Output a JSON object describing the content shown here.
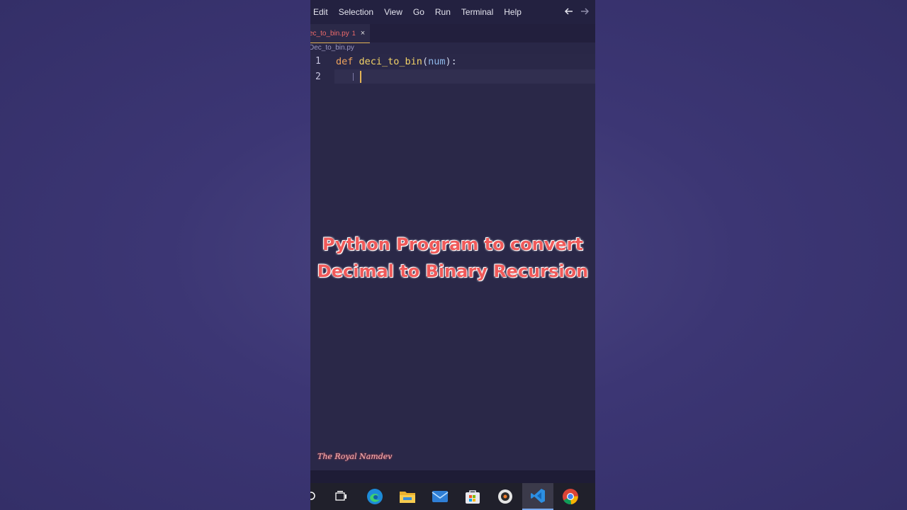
{
  "menu": {
    "items": [
      "Edit",
      "Selection",
      "View",
      "Go",
      "Run",
      "Terminal",
      "Help"
    ],
    "back_icon": "arrow-left-icon",
    "forward_icon": "arrow-right-icon"
  },
  "tab": {
    "filename": "ec_to_bin.py",
    "problems": "1",
    "close": "×"
  },
  "breadcrumb": "Dec_to_bin.py",
  "editor": {
    "line_numbers": [
      "1",
      "2"
    ],
    "code": {
      "keyword": "def",
      "function": "deci_to_bin",
      "open_paren": "(",
      "param": "num",
      "close_paren": "):"
    }
  },
  "overlay": {
    "caption_line1": "Python Program to convert",
    "caption_line2": "Decimal to Binary Recursion",
    "signature": "The Royal Namdev"
  },
  "taskbar": {
    "apps": [
      "search-icon",
      "task-view-icon",
      "edge-icon",
      "file-explorer-icon",
      "mail-icon",
      "store-icon",
      "media-icon",
      "vscode-icon",
      "chrome-icon"
    ],
    "active": "vscode-icon"
  },
  "colors": {
    "accent": "#e5b455",
    "caption": "#f05a5a",
    "keyword": "#f0a35c",
    "function": "#f2d267",
    "param": "#8fb8ea"
  }
}
